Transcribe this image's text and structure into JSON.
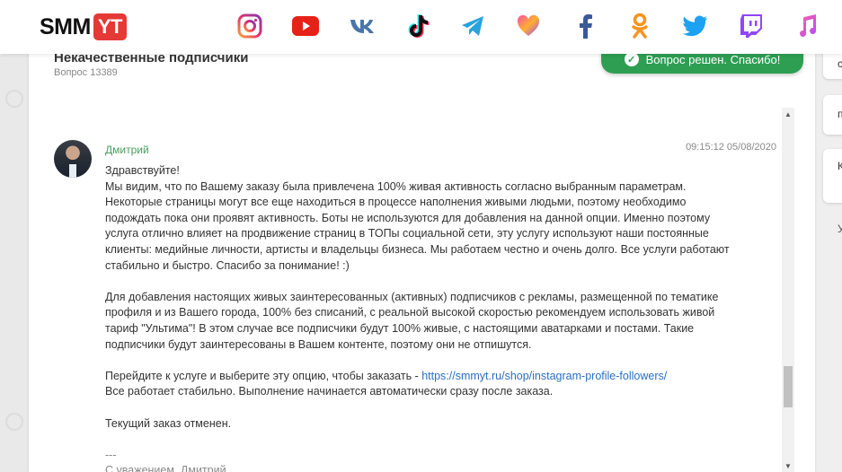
{
  "header": {
    "logo_smm": "SMM",
    "logo_yt": "YT",
    "social_icons": [
      "instagram-icon",
      "youtube-icon",
      "vk-icon",
      "tiktok-icon",
      "telegram-icon",
      "likee-icon",
      "facebook-icon",
      "odnoklassniki-icon",
      "twitter-icon",
      "twitch-icon",
      "apple-music-icon"
    ]
  },
  "ticket": {
    "title": "Некачественные подписчики",
    "number": "Вопрос 13389",
    "resolved_label": "Вопрос решен. Спасибо!"
  },
  "message": {
    "author": "Дмитрий",
    "timestamp": "09:15:12 05/08/2020",
    "lines": {
      "greeting": "Здравствуйте!",
      "p1": "Мы видим, что по Вашему заказу была привлечена 100% живая активность согласно выбранным параметрам. Некоторые страницы могут все еще находиться в процессе наполнения живыми людьми, поэтому необходимо подождать пока они проявят активность. Боты не используются для добавления на данной опции. Именно поэтому услуга отлично влияет на продвижение страниц в ТОПы социальной сети, эту услугу используют наши постоянные клиенты: медийные личности, артисты и владельцы бизнеса. Мы работаем честно и очень долго. Все услуги работают стабильно и быстро. Спасибо за понимание! :)",
      "p2": "Для добавления настоящих живых заинтересованных (активных) подписчиков с рекламы, размещенной по тематике профиля и из Вашего города, 100% без списаний, с реальной высокой скоростью рекомендуем использовать живой тариф \"Ультима\"! В этом случае все подписчики будут 100% живые, с настоящими аватарками и постами. Такие подписчики будут заинтересованы в Вашем контенте, поэтому они не отпишутся.",
      "p3_prefix": "Перейдите к услуге и выберите эту опцию, чтобы заказать - ",
      "p3_link": "https://smmyt.ru/shop/instagram-profile-followers/",
      "p3_suffix": "Все работает стабильно. Выполнение начинается автоматически сразу после заказа.",
      "p4": "Текущий заказ отменен.",
      "sig_dash": "---",
      "sig": "С уважением, Дмитрий"
    }
  },
  "side_cards": [
    "c",
    "п",
    "К"
  ],
  "side_text": "У",
  "colors": {
    "accent_green": "#2e9e53",
    "author_green": "#4a9d5e",
    "link_blue": "#2a6fc2",
    "logo_red": "#e53935"
  }
}
